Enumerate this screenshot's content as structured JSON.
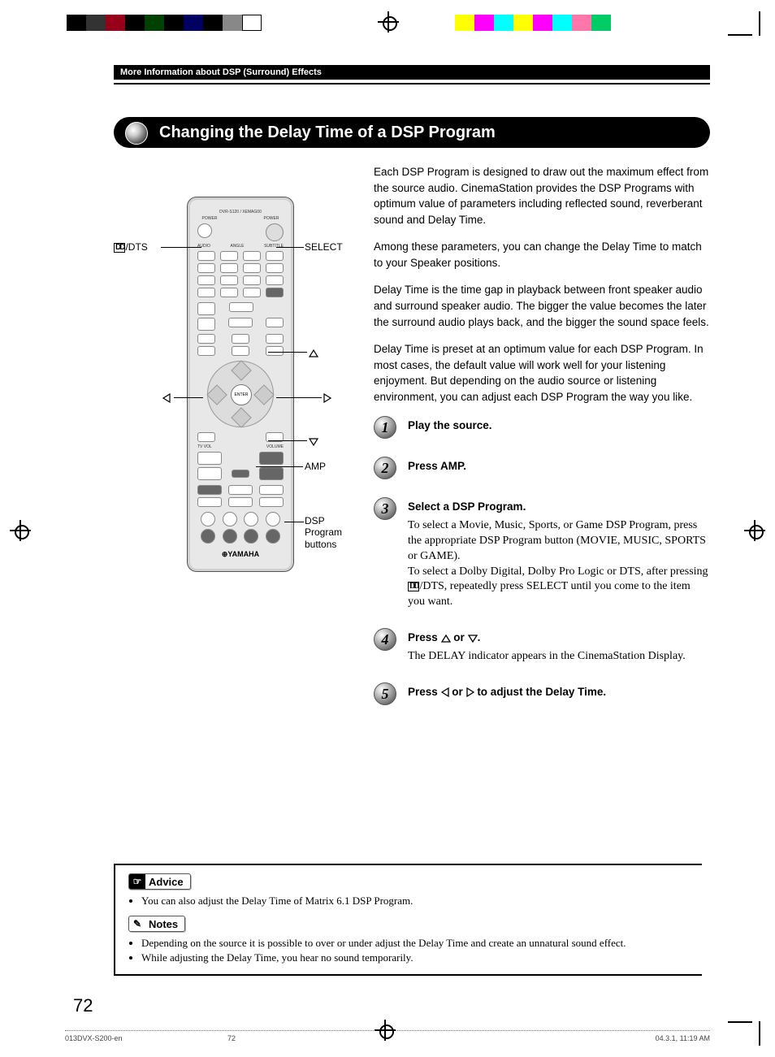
{
  "header": {
    "breadcrumb": "More Information about DSP (Surround) Effects",
    "title": "Changing the Delay Time of a DSP Program"
  },
  "intro": {
    "p1": "Each DSP Program is designed to draw out the maximum effect from the source audio. CinemaStation provides the DSP Programs with optimum value of parameters including reflected sound, reverberant sound and Delay Time.",
    "p2": "Among these parameters, you can change the Delay Time to match to your Speaker positions.",
    "p3": "Delay Time is the time gap in playback between front speaker audio and surround speaker audio. The bigger the value becomes the later the surround audio plays back, and the bigger the sound space feels.",
    "p4": "Delay Time is preset at an optimum value for each DSP Program. In most cases, the default value will work well for your listening enjoyment. But depending on the audio source or listening environment, you can adjust each DSP Program the way you like."
  },
  "remote_labels": {
    "dts": "/DTS",
    "select": "SELECT",
    "amp": "AMP",
    "dsp_buttons_l1": "DSP",
    "dsp_buttons_l2": "Program",
    "dsp_buttons_l3": "buttons"
  },
  "steps": [
    {
      "num": "1",
      "title": "Play the source.",
      "detail": ""
    },
    {
      "num": "2",
      "title": "Press AMP.",
      "detail": ""
    },
    {
      "num": "3",
      "title": "Select a DSP Program.",
      "detail_a": "To select a Movie, Music, Sports, or Game DSP Program, press the appropriate DSP Program button (MOVIE, MUSIC, SPORTS or GAME).",
      "detail_b_pre": "To select a Dolby Digital, Dolby Pro Logic or DTS, after pressing ",
      "detail_b_post": "/DTS, repeatedly press SELECT until you come to the item you want."
    },
    {
      "num": "4",
      "title_pre": "Press ",
      "title_mid": " or ",
      "title_post": ".",
      "detail": "The DELAY indicator appears in the CinemaStation Display."
    },
    {
      "num": "5",
      "title_pre": "Press ",
      "title_mid": " or ",
      "title_post": " to adjust the Delay Time.",
      "detail": ""
    }
  ],
  "advice": {
    "label": "Advice",
    "items": [
      "You can also adjust the Delay Time of Matrix 6.1 DSP Program."
    ]
  },
  "notes": {
    "label": "Notes",
    "items": [
      "Depending on the source it is possible to over or under adjust the Delay Time and create an unnatural sound effect.",
      "While adjusting the Delay Time, you hear no sound temporarily."
    ]
  },
  "page_number": "72",
  "footer": {
    "left": "013DVX-S200-en",
    "mid": "72",
    "right": "04.3.1, 11:19 AM"
  }
}
